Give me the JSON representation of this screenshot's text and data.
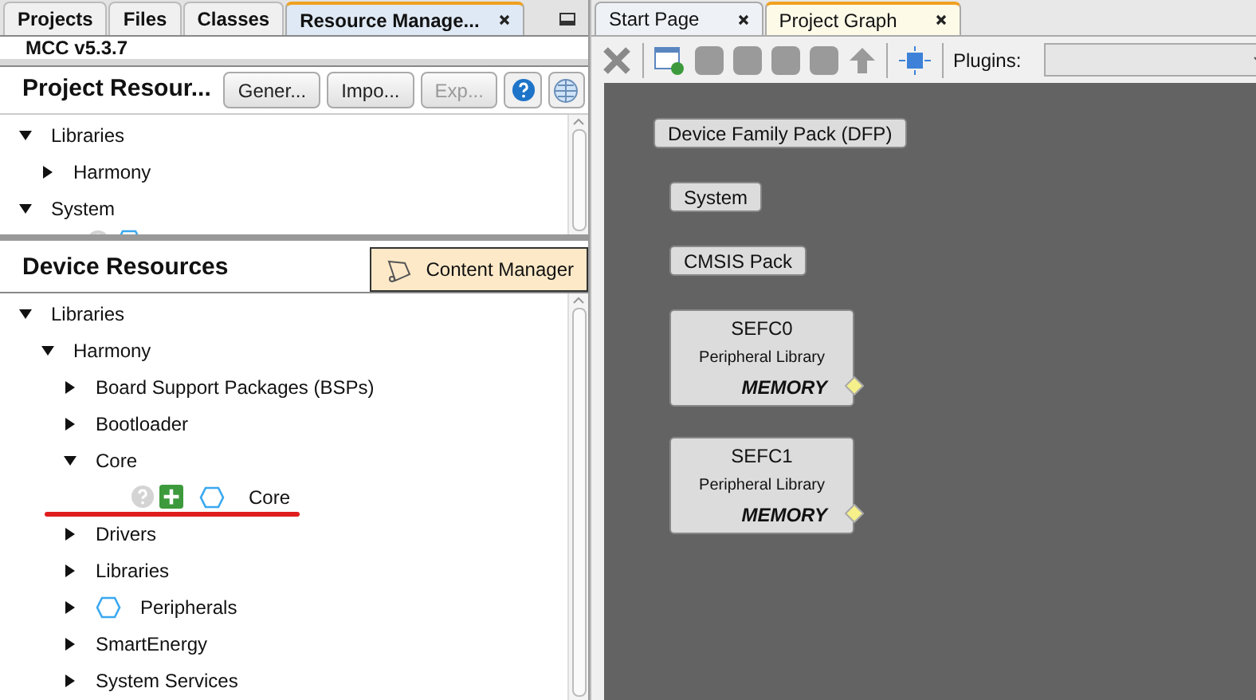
{
  "left_tabs": [
    {
      "label": "Projects",
      "selected": false,
      "closable": false
    },
    {
      "label": "Files",
      "selected": false,
      "closable": false
    },
    {
      "label": "Classes",
      "selected": false,
      "closable": false
    },
    {
      "label": "Resource Manage...",
      "selected": true,
      "closable": true
    }
  ],
  "version": "MCC v5.3.7",
  "project_resources": {
    "title": "Project Resour...",
    "buttons": [
      {
        "label": "Gener...",
        "disabled": false
      },
      {
        "label": "Impo...",
        "disabled": false
      },
      {
        "label": "Exp...",
        "disabled": true
      }
    ],
    "tree": [
      {
        "label": "Libraries",
        "kind": "group",
        "expanded": true,
        "children": [
          {
            "label": "Harmony",
            "kind": "group",
            "expanded": false
          }
        ]
      },
      {
        "label": "System",
        "kind": "group",
        "expanded": true,
        "children": [
          {
            "kind": "component-clipped"
          }
        ]
      }
    ]
  },
  "device_resources": {
    "title": "Device Resources",
    "content_manager": "Content Manager",
    "tree": [
      {
        "label": "Libraries",
        "kind": "group",
        "expanded": true,
        "children": [
          {
            "label": "Harmony",
            "kind": "group",
            "expanded": true,
            "children": [
              {
                "label": "Board Support Packages (BSPs)",
                "kind": "group",
                "expanded": false
              },
              {
                "label": "Bootloader",
                "kind": "group",
                "expanded": false
              },
              {
                "label": "Core",
                "kind": "group",
                "expanded": true,
                "children": [
                  {
                    "label": "Core",
                    "kind": "component",
                    "underlined": true
                  }
                ]
              },
              {
                "label": "Drivers",
                "kind": "group",
                "expanded": false
              },
              {
                "label": "Libraries",
                "kind": "group",
                "expanded": false
              },
              {
                "label": "Peripherals",
                "kind": "group-hex",
                "expanded": false
              },
              {
                "label": "SmartEnergy",
                "kind": "group",
                "expanded": false
              },
              {
                "label": "System Services",
                "kind": "group",
                "expanded": false
              }
            ]
          }
        ]
      }
    ]
  },
  "right_tabs": [
    {
      "label": "Start Page",
      "selected": false
    },
    {
      "label": "Project Graph",
      "selected": true
    }
  ],
  "plugins_label": "Plugins:",
  "graph_nodes": [
    {
      "kind": "simple",
      "title": "Device Family Pack (DFP)"
    },
    {
      "kind": "simple",
      "title": "System"
    },
    {
      "kind": "simple",
      "title": "CMSIS Pack"
    },
    {
      "kind": "component",
      "title": "SEFC0",
      "subtitle": "Peripheral Library",
      "port": "MEMORY"
    },
    {
      "kind": "component",
      "title": "SEFC1",
      "subtitle": "Peripheral Library",
      "port": "MEMORY"
    }
  ]
}
